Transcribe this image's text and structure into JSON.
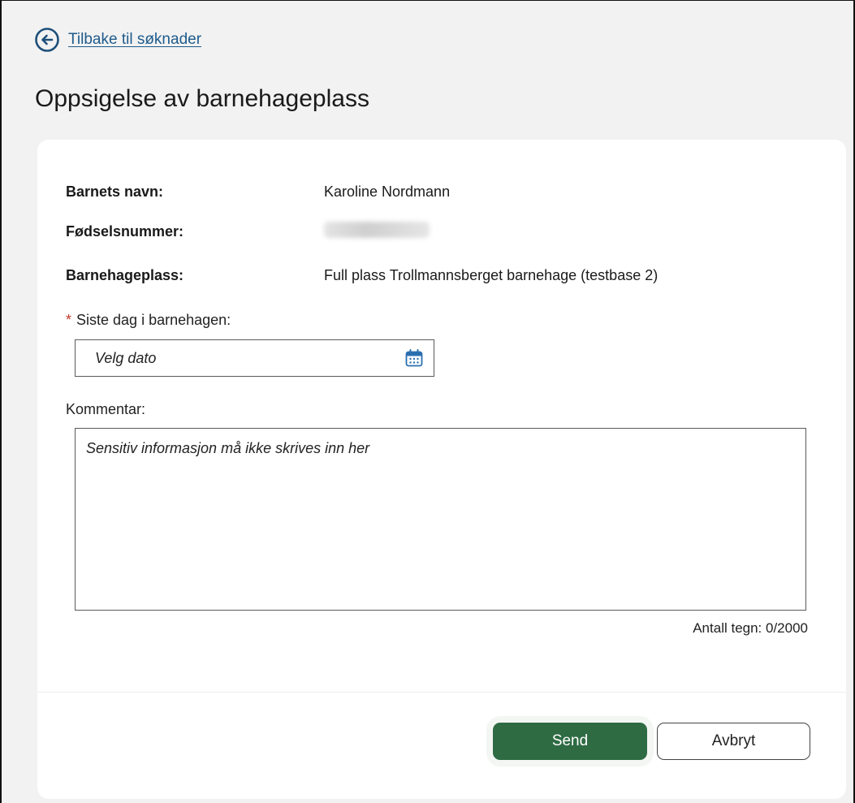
{
  "nav": {
    "back_label": "Tilbake til søknader"
  },
  "page": {
    "title": "Oppsigelse av barnehageplass"
  },
  "info": {
    "child_name_label": "Barnets navn:",
    "child_name_value": "Karoline Nordmann",
    "ssn_label": "Fødselsnummer:",
    "placement_label": "Barnehageplass:",
    "placement_value": "Full plass Trollmannsberget barnehage (testbase 2)"
  },
  "form": {
    "required_marker": "*",
    "last_day_label": "Siste dag i barnehagen:",
    "date_placeholder": "Velg dato",
    "comment_label": "Kommentar:",
    "comment_placeholder": "Sensitiv informasjon må ikke skrives inn her",
    "char_count": "Antall tegn: 0/2000"
  },
  "actions": {
    "send_label": "Send",
    "cancel_label": "Avbryt"
  },
  "colors": {
    "primary": "#2e6b43",
    "link": "#1f5b8c",
    "required": "#c0392b",
    "background": "#f2f2f2"
  },
  "icons": {
    "back": "arrow-left-circle-icon",
    "date": "calendar-icon"
  }
}
